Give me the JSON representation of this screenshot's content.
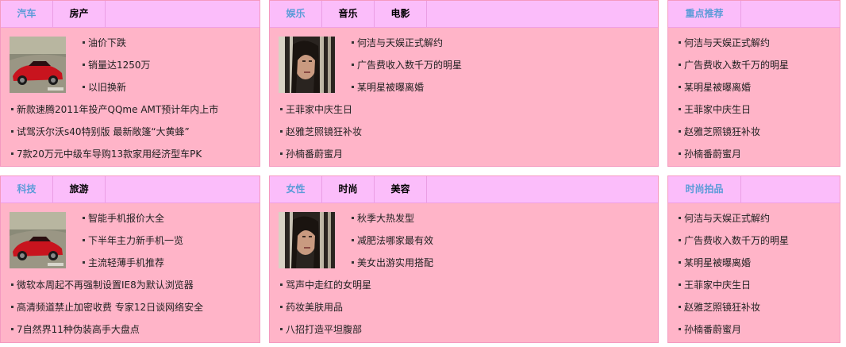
{
  "panels": [
    {
      "tabs": [
        "汽车",
        "房产"
      ],
      "image": "red-sports-car",
      "side_items": [
        "油价下跌",
        "销量达1250万",
        "以旧换新"
      ],
      "items": [
        "新款速腾2011年投产QQme AMT预计年内上市",
        "试驾沃尔沃s40特别版 最新敞篷“大黄蜂”",
        "7款20万元中级车导购13款家用经济型车PK"
      ]
    },
    {
      "tabs": [
        "娱乐",
        "音乐",
        "电影"
      ],
      "image": "actress-portrait",
      "side_items": [
        "何洁与天娱正式解约",
        "广告费收入数千万的明星",
        "某明星被曝离婚"
      ],
      "items": [
        "王菲家中庆生日",
        "赵雅芝照镜狂补妆",
        "孙楠番蔚蜜月"
      ]
    },
    {
      "tabs": [
        "重点推荐"
      ],
      "items": [
        "何洁与天娱正式解约",
        "广告费收入数千万的明星",
        "某明星被曝离婚",
        "王菲家中庆生日",
        "赵雅芝照镜狂补妆",
        "孙楠番蔚蜜月"
      ]
    },
    {
      "tabs": [
        "科技",
        "旅游"
      ],
      "image": "red-sports-car",
      "side_items": [
        "智能手机报价大全",
        "下半年主力新手机一览",
        "主流轻薄手机推荐"
      ],
      "items": [
        "微软本周起不再强制设置IE8为默认浏览器",
        "高清频道禁止加密收费 专家12日谈网络安全",
        "7自然界11种伪装高手大盘点"
      ]
    },
    {
      "tabs": [
        "女性",
        "时尚",
        "美容"
      ],
      "image": "actress-portrait",
      "side_items": [
        "秋季大热发型",
        "减肥法哪家最有效",
        "美女出游实用搭配"
      ],
      "items": [
        "骂声中走红的女明星",
        "药妆美肤用品",
        "八招打造平坦腹部"
      ]
    },
    {
      "tabs": [
        "时尚拍品"
      ],
      "items": [
        "何洁与天娱正式解约",
        "广告费收入数千万的明星",
        "某明星被曝离婚",
        "王菲家中庆生日",
        "赵雅芝照镜狂补妆",
        "孙楠番蔚蜜月"
      ]
    }
  ],
  "colors": {
    "panel_bg": "#ffb4c8",
    "tabbar_bg": "#fbbdfa",
    "active_tab": "#5b9bd8"
  }
}
